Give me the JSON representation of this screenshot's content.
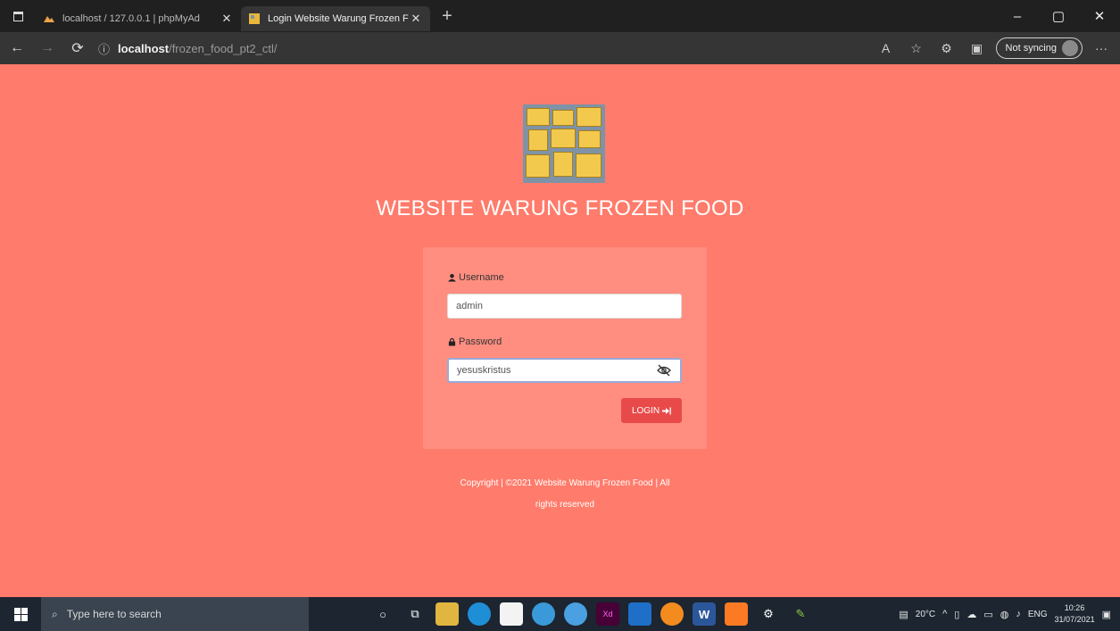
{
  "browser": {
    "tabs": [
      {
        "title": "localhost / 127.0.0.1 | phpMyAd",
        "active": false
      },
      {
        "title": "Login Website Warung Frozen F",
        "active": true
      }
    ],
    "new_tab_symbol": "+",
    "address": {
      "host": "localhost",
      "path": "/frozen_food_pt2_ctl/"
    },
    "sync_label": "Not syncing",
    "more_symbol": "···",
    "window_controls": {
      "minimize": "–",
      "maximize": "▢",
      "close": "✕"
    }
  },
  "page": {
    "title": "WEBSITE WARUNG FROZEN FOOD",
    "username": {
      "label": "Username",
      "value": "admin"
    },
    "password": {
      "label": "Password",
      "value": "yesuskristus"
    },
    "login_button": "LOGIN",
    "copyright_line1": "Copyright | ©2021 Website Warung Frozen Food | All",
    "copyright_line2": "rights reserved",
    "background_color": "#ff7b6b",
    "card_color": "#ff8e80",
    "button_color": "#e84a4a"
  },
  "taskbar": {
    "search_placeholder": "Type here to search",
    "weather": "20°C",
    "language": "ENG",
    "time": "10:26",
    "date": "31/07/2021"
  }
}
